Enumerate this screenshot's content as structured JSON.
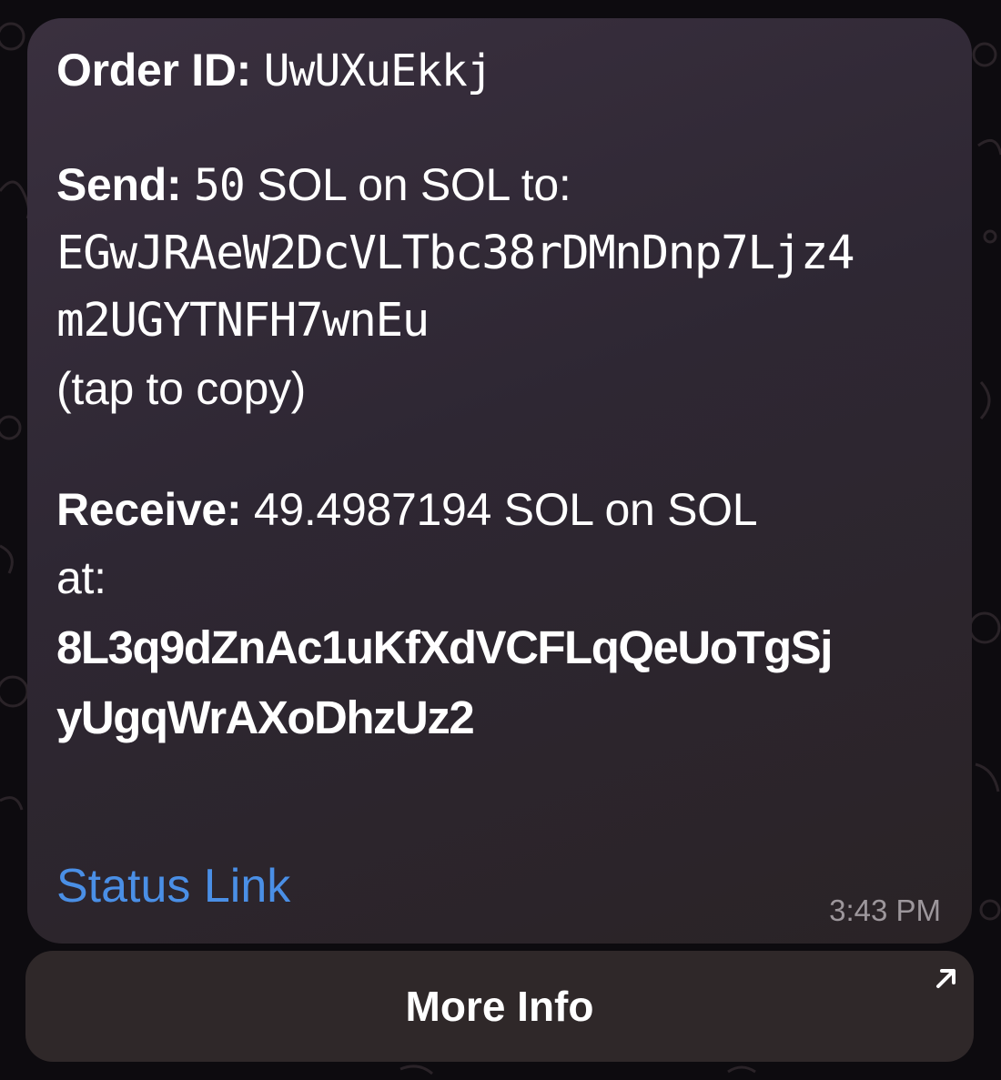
{
  "message": {
    "order_id_label": "Order ID:",
    "order_id_value": "UwUXuEkkj",
    "send_label": "Send:",
    "send_amount": "50",
    "send_rest": " SOL on SOL to:",
    "send_address_line1": "EGwJRAeW2DcVLTbc38rDMnDnp7Ljz4",
    "send_address_line2": "m2UGYTNFH7wnEu",
    "copy_hint": "(tap to copy)",
    "receive_label": "Receive:",
    "receive_rest": " 49.4987194 SOL on SOL",
    "receive_at": "at:",
    "receive_address_line1": "8L3q9dZnAc1uKfXdVCFLqQeUoTgSj",
    "receive_address_line2": "yUgqWrAXoDhzUz2",
    "status_link_text": "Status Link",
    "timestamp": "3:43 PM"
  },
  "button": {
    "more_info_label": "More Info",
    "icon": "arrow-up-right-icon"
  },
  "colors": {
    "link": "#4a8fe6",
    "bubble": "#2e2733",
    "timestamp": "#9d979c"
  }
}
